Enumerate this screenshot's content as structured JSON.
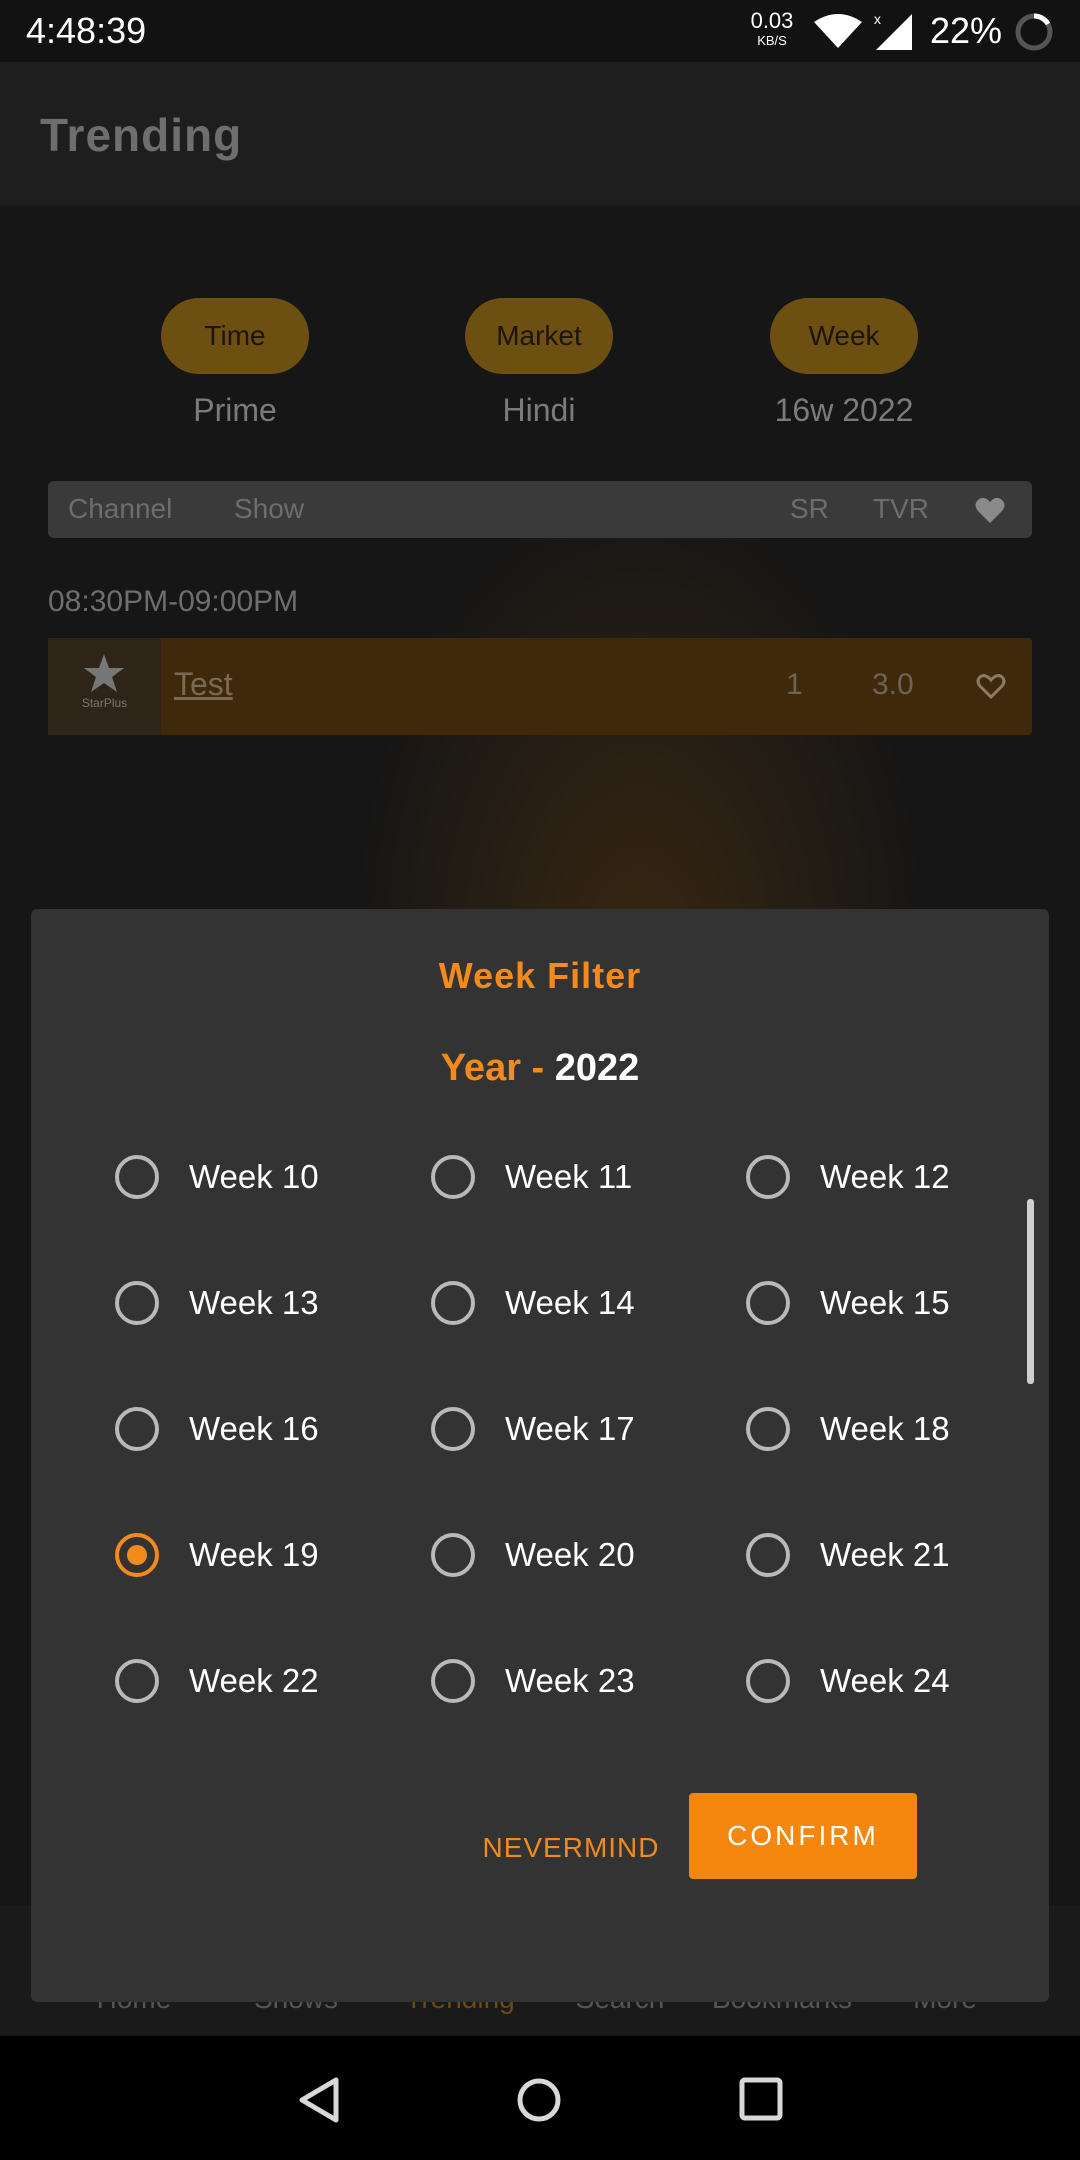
{
  "status_bar": {
    "time": "4:48:39",
    "net_speed_value": "0.03",
    "net_speed_unit": "KB/S",
    "battery_pct": "22%"
  },
  "app_bar": {
    "title": "Trending"
  },
  "filters": [
    {
      "chip": "Time",
      "value": "Prime"
    },
    {
      "chip": "Market",
      "value": "Hindi"
    },
    {
      "chip": "Week",
      "value": "16w 2022"
    }
  ],
  "table": {
    "headers": {
      "channel": "Channel",
      "show": "Show",
      "sr": "SR",
      "tvr": "TVR"
    },
    "timeslot": "08:30PM-09:00PM",
    "rows": [
      {
        "channel_logo": "StarPlus",
        "show": "Test",
        "sr": "1",
        "tvr": "3.0"
      }
    ]
  },
  "bottom_nav": {
    "items": [
      "Home",
      "Shows",
      "Trending",
      "Search",
      "Bookmarks",
      "More"
    ],
    "active": "Trending"
  },
  "dialog": {
    "title": "Week Filter",
    "year_label": "Year - ",
    "year_value": "2022",
    "weeks": [
      "Week 10",
      "Week 11",
      "Week 12",
      "Week 13",
      "Week 14",
      "Week 15",
      "Week 16",
      "Week 17",
      "Week 18",
      "Week 19",
      "Week 20",
      "Week 21",
      "Week 22",
      "Week 23",
      "Week 24"
    ],
    "selected_week": "Week 19",
    "cancel_label": "NEVERMIND",
    "confirm_label": "CONFIRM"
  },
  "colors": {
    "accent": "#f28a1c",
    "confirm_bg": "#f5870e",
    "dialog_bg": "#333333",
    "page_bg": "#161616"
  }
}
